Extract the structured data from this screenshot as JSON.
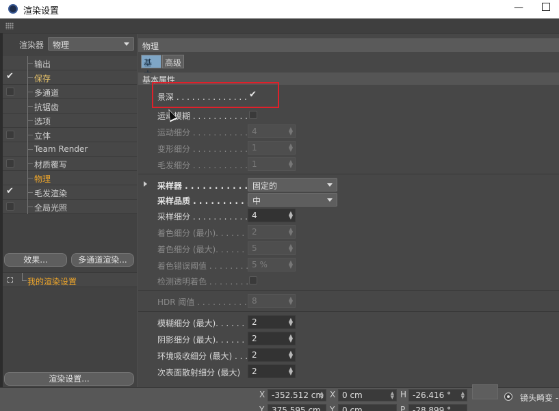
{
  "window": {
    "title": "渲染设置",
    "minimize": "—"
  },
  "renderer": {
    "label": "渲染器",
    "value": "物理"
  },
  "tree": [
    {
      "label": "输出",
      "checkbox": "none",
      "state": "normal"
    },
    {
      "label": "保存",
      "checkbox": "checked",
      "state": "saved"
    },
    {
      "label": "多通道",
      "checkbox": "unchecked",
      "state": "normal"
    },
    {
      "label": "抗锯齿",
      "checkbox": "none",
      "state": "normal"
    },
    {
      "label": "选项",
      "checkbox": "none",
      "state": "normal"
    },
    {
      "label": "立体",
      "checkbox": "unchecked",
      "state": "normal"
    },
    {
      "label": "Team Render",
      "checkbox": "none",
      "state": "normal"
    },
    {
      "label": "材质覆写",
      "checkbox": "unchecked",
      "state": "normal"
    },
    {
      "label": "物理",
      "checkbox": "none",
      "state": "active"
    },
    {
      "label": "毛发渲染",
      "checkbox": "checked",
      "state": "normal"
    },
    {
      "label": "全局光照",
      "checkbox": "unchecked",
      "state": "normal"
    }
  ],
  "buttons": {
    "effects": "效果...",
    "multipass": "多通道渲染...",
    "render_settings": "渲染设置..."
  },
  "settings_list": {
    "item": "我的渲染设置"
  },
  "panel": {
    "title": "物理",
    "tabs": [
      "基本",
      "高级"
    ],
    "basic_header": "基本属性"
  },
  "props": {
    "dof": {
      "label": "景深 . . . . . . . . . . . . . . . . .",
      "checked": true
    },
    "motion_blur": {
      "label": "运动模糊 . . . . . . . . . . . . . .",
      "checked": false
    },
    "motion_subdiv": {
      "label": "运动细分 . . . . . . . . . . . . . .",
      "value": "4"
    },
    "deform_subdiv": {
      "label": "变形细分 . . . . . . . . . . . . . .",
      "value": "1"
    },
    "hair_subdiv": {
      "label": "毛发细分 . . . . . . . . . . . . . .",
      "value": "1"
    },
    "sampler": {
      "label": "采样器 . . . . . . . . . . . . . . .",
      "value": "固定的"
    },
    "sample_quality": {
      "label": "采样品质 . . . . . . . . . . . . . .",
      "value": "中"
    },
    "sample_subdiv": {
      "label": "采样细分 . . . . . . . . . . . . . .",
      "value": "4"
    },
    "shading_subdiv_min": {
      "label": "着色细分 (最小). . . . . . . . . . .",
      "value": "2"
    },
    "shading_subdiv_max": {
      "label": "着色细分 (最大). . . . . . . . . . .",
      "value": "5"
    },
    "shading_error": {
      "label": "着色错误阈值 . . . . . . . . . . .",
      "value": "5 %"
    },
    "detect_transparent": {
      "label": "检测透明着色 . . . . . . . . . . .",
      "checked": false
    },
    "hdr_threshold": {
      "label": "HDR 阈值 . . . . . . . . . . . . .",
      "value": "8"
    },
    "blur_subdiv": {
      "label": "模糊细分 (最大). . . . . . . . . . .",
      "value": "2"
    },
    "shadow_subdiv": {
      "label": "阴影细分 (最大). . . . . . . . . . .",
      "value": "2"
    },
    "ao_subdiv": {
      "label": "环境吸收细分 (最大) . . . . . . . .",
      "value": "2"
    },
    "sss_subdiv": {
      "label": "次表面散射细分 (最大)",
      "value": "2"
    }
  },
  "coords": {
    "row1": [
      {
        "axis": "X",
        "value": "-352.512 cm"
      },
      {
        "axis": "X",
        "value": "0 cm"
      },
      {
        "axis": "H",
        "value": "-26.416 °"
      }
    ],
    "row2": [
      {
        "axis": "Y",
        "value": "375.595 cm"
      },
      {
        "axis": "Y",
        "value": "0 cm"
      },
      {
        "axis": "P",
        "value": "-28.899 °"
      }
    ]
  },
  "lens_distortion": "镜头畸变 -",
  "highlight_color": "#e0202a",
  "active_color": "#f0a72a",
  "icons": [
    "cinema4d-app-icon",
    "grip-icon",
    "checkmark-icon",
    "settings-icon",
    "radio-icon",
    "cube-icon"
  ]
}
